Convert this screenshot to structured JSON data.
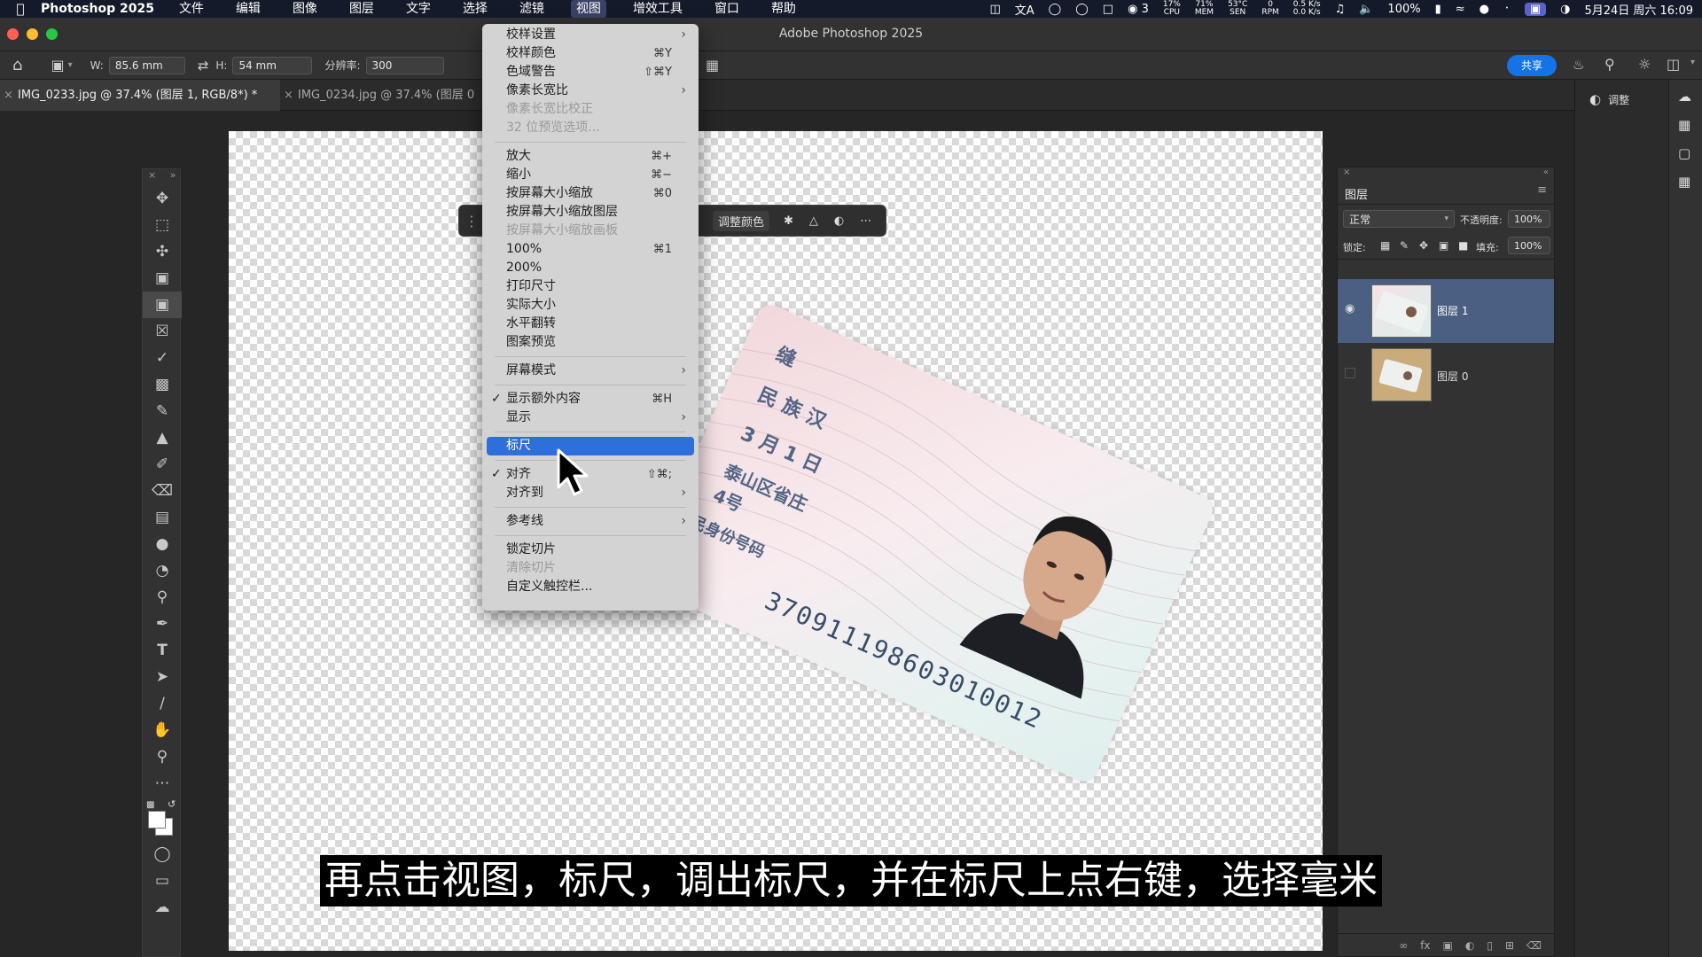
{
  "menubar": {
    "app_name": "Photoshop 2025",
    "menus": [
      "文件",
      "编辑",
      "图像",
      "图层",
      "文字",
      "选择",
      "滤镜",
      "视图",
      "增效工具",
      "窗口",
      "帮助"
    ],
    "status": {
      "wechat_count": "3",
      "cpu": "17%",
      "cpu_label": "CPU",
      "mem": "71%",
      "mem_label": "MEM",
      "temp": "53°C",
      "temp_label": "SEN",
      "rpm": "0",
      "rpm_label": "RPM",
      "net_up": "0.5 K/s",
      "net_down": "0.0 K/s",
      "battery": "100%",
      "datetime": "5月24日 周六 16:09"
    }
  },
  "window": {
    "title": "Adobe Photoshop 2025"
  },
  "options": {
    "w_label": "W:",
    "w_value": "85.6 mm",
    "h_label": "H:",
    "h_value": "54 mm",
    "res_label": "分辨率:",
    "res_value": "300",
    "share_label": "共享"
  },
  "tabs": [
    {
      "label": "IMG_0233.jpg @ 37.4% (图层 1, RGB/8*) *"
    },
    {
      "label": "IMG_0234.jpg @ 37.4% (图层 0"
    }
  ],
  "taskbar": {
    "adjust_color": "调整颜色"
  },
  "view_menu": {
    "items": [
      {
        "label": "校样设置",
        "shortcut": "",
        "arrow": true,
        "disabled": false
      },
      {
        "label": "校样颜色",
        "shortcut": "⌘Y",
        "disabled": false
      },
      {
        "label": "色域警告",
        "shortcut": "⇧⌘Y",
        "disabled": false
      },
      {
        "label": "像素长宽比",
        "shortcut": "",
        "arrow": true,
        "disabled": false
      },
      {
        "label": "像素长宽比校正",
        "shortcut": "",
        "disabled": true
      },
      {
        "label": "32 位预览选项...",
        "shortcut": "",
        "disabled": true
      },
      {
        "label": "放大",
        "shortcut": "⌘+",
        "disabled": false
      },
      {
        "label": "缩小",
        "shortcut": "⌘−",
        "disabled": false
      },
      {
        "label": "按屏幕大小缩放",
        "shortcut": "⌘0",
        "disabled": false
      },
      {
        "label": "按屏幕大小缩放图层",
        "shortcut": "",
        "disabled": false
      },
      {
        "label": "按屏幕大小缩放画板",
        "shortcut": "",
        "disabled": true
      },
      {
        "label": "100%",
        "shortcut": "⌘1",
        "disabled": false
      },
      {
        "label": "200%",
        "shortcut": "",
        "disabled": false
      },
      {
        "label": "打印尺寸",
        "shortcut": "",
        "disabled": false
      },
      {
        "label": "实际大小",
        "shortcut": "",
        "disabled": false
      },
      {
        "label": "水平翻转",
        "shortcut": "",
        "disabled": false
      },
      {
        "label": "图案预览",
        "shortcut": "",
        "disabled": false
      },
      {
        "label": "屏幕模式",
        "shortcut": "",
        "arrow": true,
        "disabled": false
      },
      {
        "label": "显示额外内容",
        "shortcut": "⌘H",
        "checked": true,
        "disabled": false
      },
      {
        "label": "显示",
        "shortcut": "",
        "arrow": true,
        "disabled": false
      },
      {
        "label": "标尺",
        "shortcut": "",
        "highlighted": true,
        "disabled": false
      },
      {
        "label": "对齐",
        "shortcut": "⇧⌘;",
        "checked": true,
        "disabled": false
      },
      {
        "label": "对齐到",
        "shortcut": "",
        "arrow": true,
        "disabled": false
      },
      {
        "label": "参考线",
        "shortcut": "",
        "arrow": true,
        "disabled": false
      },
      {
        "label": "锁定切片",
        "shortcut": "",
        "disabled": false
      },
      {
        "label": "清除切片",
        "shortcut": "",
        "disabled": true
      },
      {
        "label": "自定义触控栏...",
        "shortcut": "",
        "disabled": false
      }
    ]
  },
  "id_card": {
    "text_lines": [
      "缝",
      "民 族 汉",
      "3 月 1 日",
      "泰山区省庄",
      "4号",
      "公民身份号码"
    ],
    "number": "370911198603010012"
  },
  "adjust_panel": {
    "label": "调整"
  },
  "layers_panel": {
    "title": "图层",
    "blend_mode": "正常",
    "opacity_label": "不透明度:",
    "opacity_value": "100%",
    "lock_label": "锁定:",
    "fill_label": "填充:",
    "fill_value": "100%",
    "layers": [
      {
        "name": "图层 1",
        "visible": true,
        "selected": true
      },
      {
        "name": "图层 0",
        "visible": false,
        "selected": false
      }
    ]
  },
  "subtitle": "再点击视图，标尺，调出标尺，并在标尺上点右键，选择毫米",
  "colors": {
    "accent": "#2f6fd9",
    "share": "#1473e6",
    "layer_selected": "#4a5f82"
  }
}
